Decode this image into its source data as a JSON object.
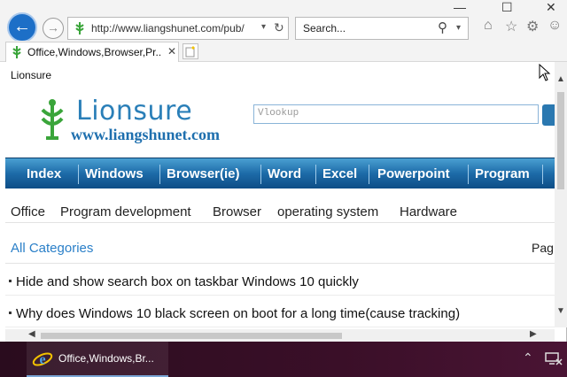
{
  "browser": {
    "address_bar": {
      "url": "http://www.liangshunet.com/pub/"
    },
    "search_bar": {
      "placeholder": "Search..."
    },
    "tabs": [
      {
        "label": "Office,Windows,Browser,Pr..."
      }
    ]
  },
  "page": {
    "caption": "Lionsure",
    "logo": {
      "name": "Lionsure",
      "url": "www.liangshunet.com"
    },
    "site_search": {
      "value": "Vlookup"
    },
    "menu": [
      {
        "label": "Index"
      },
      {
        "label": "Windows"
      },
      {
        "label": "Browser(ie)"
      },
      {
        "label": "Word"
      },
      {
        "label": "Excel"
      },
      {
        "label": "Powerpoint"
      },
      {
        "label": "Program"
      }
    ],
    "sub_nav": [
      {
        "label": "Office"
      },
      {
        "label": "Program development"
      },
      {
        "label": "Browser"
      },
      {
        "label": "operating system"
      },
      {
        "label": "Hardware"
      }
    ],
    "category_title": "All Categories",
    "pagination_label": "Pag",
    "articles": [
      {
        "title": "Hide and show search box on taskbar Windows 10 quickly"
      },
      {
        "title": "Why does Windows 10 black screen on boot for a long time(cause tracking)"
      }
    ]
  },
  "taskbar": {
    "items": [
      {
        "label": "Office,Windows,Br..."
      }
    ]
  },
  "colors": {
    "accent": "#1d6fc7",
    "logo_blue": "#2a7fb8",
    "menu_bar": "#1d6ba8",
    "link": "#2a7fc8"
  }
}
